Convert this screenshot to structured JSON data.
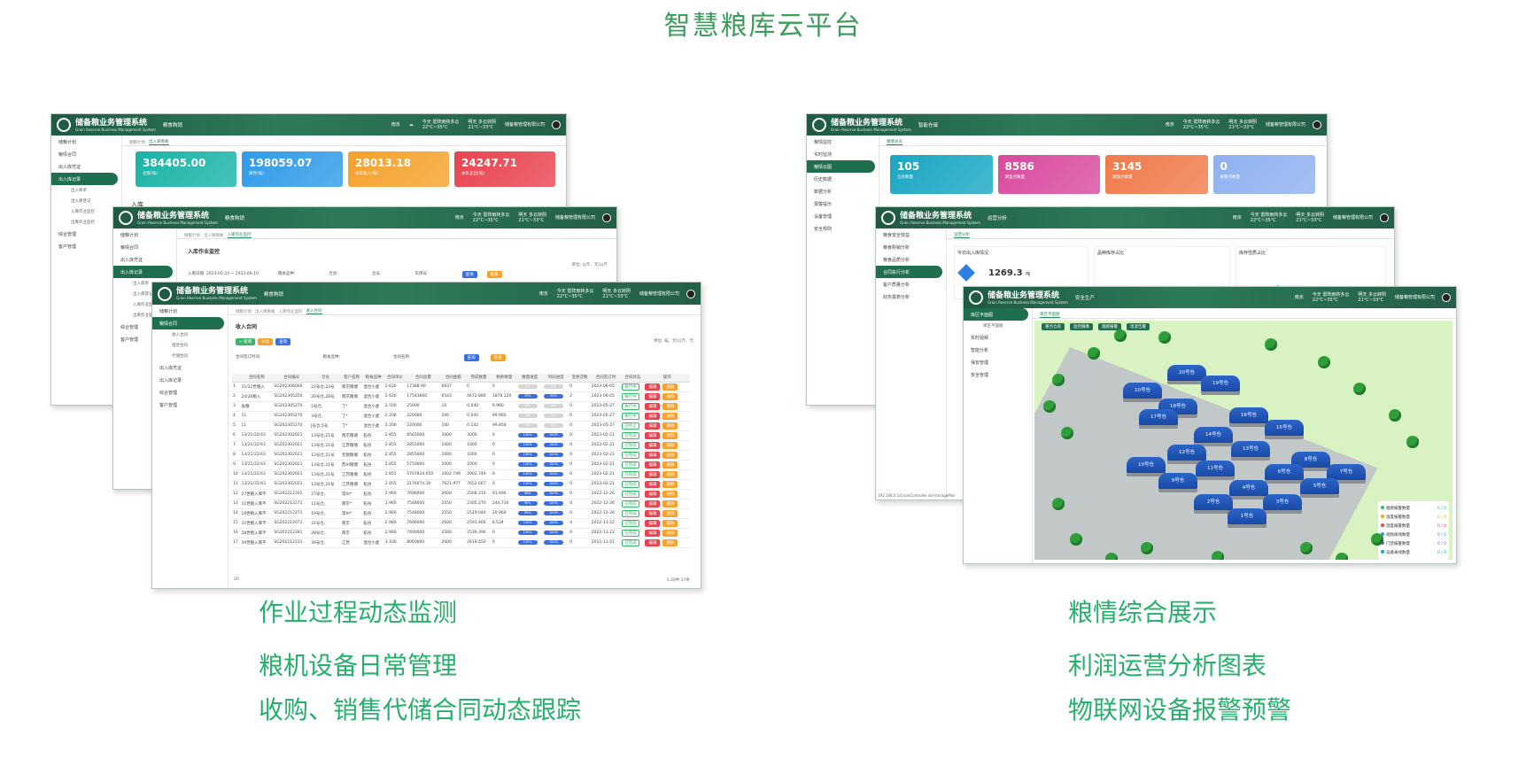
{
  "page_title": "智慧粮库云平台",
  "captions_left": [
    "作业过程动态监测",
    "粮机设备日常管理",
    "收购、销售代储合同动态跟踪"
  ],
  "captions_right": [
    "粮情综合展示",
    "利润运营分析图表",
    "物联网设备报警预警"
  ],
  "app": {
    "name": "储备粮业务管理系统",
    "subtitle": "Grain Reserve Business Management System",
    "weather_city": "南京",
    "weather_today": "今天 雷阵雨转多云",
    "weather_today_temp": "22°C~35°C",
    "weather_tomorrow": "明天 多云转阴",
    "weather_tomorrow_temp": "21°C~33°C",
    "company": "储备粮管理有限公司",
    "user": "超级管理员"
  },
  "w1": {
    "module": "粮食购销",
    "sidebar": [
      "储粮计划",
      "粮情合同",
      "出入库凭证",
      "出入库记录",
      "出入库单",
      "出入库登记",
      "入库作业监控",
      "出库作业监控",
      "综合管理",
      "客户管理"
    ],
    "tabs": [
      "储粮计划",
      "出入库看板"
    ],
    "cards": [
      {
        "value": "384405.00",
        "label": "仓容(吨)",
        "color": "#19b3a6"
      },
      {
        "value": "198059.07",
        "label": "库存(吨)",
        "color": "#2f9be8"
      },
      {
        "value": "28013.18",
        "label": "本年收入(吨)",
        "color": "#f5a12b"
      },
      {
        "value": "24247.71",
        "label": "本年支出(吨)",
        "color": "#e9434f"
      }
    ],
    "section": "入库"
  },
  "w2": {
    "module": "粮食购销",
    "sidebar": [
      "储粮计划",
      "粮情合同",
      "出入库凭证",
      "出入库记录",
      "出入库单",
      "出入库登记",
      "入库作业监控",
      "出库作业监控",
      "综合管理",
      "客户管理"
    ],
    "tabs": [
      "储粮计划",
      "出入库看板",
      "入库作业监控"
    ],
    "panel_title": "入库作业监控",
    "unit": "单位: 公斤、元/公斤",
    "filter_date": "入库日期: 2023-05-24 ~ 2023-06-10",
    "filter_grain": "粮食品种:",
    "filter_house": "仓房:",
    "filter_bin": "仓号:",
    "filter_car": "车牌号:",
    "query": "查询",
    "reset": "重置"
  },
  "w3": {
    "module": "粮食购销",
    "sidebar": [
      "储粮计划",
      "粮情合同",
      "收入合同",
      "租赁合同",
      "代储合同",
      "出入库凭证",
      "出入库记录",
      "综合管理",
      "客户管理"
    ],
    "tabs": [
      "储粮计划",
      "出入库看板",
      "入库作业监控",
      "收入合同"
    ],
    "panel_title": "收入合同",
    "unit": "单位: 吨、元/公斤、元",
    "btn_add": "+ 新增",
    "btn_import": "导出",
    "btn_search": "查询",
    "query": "查询",
    "reset": "重置",
    "filter_date": "合同签订时间:",
    "filter_grain": "粮食品种:",
    "filter_name": "合同名称:",
    "columns": [
      "",
      "合同名称",
      "合同编号",
      "仓号",
      "客户名称",
      "粮食品种",
      "合同单价",
      "合同总量",
      "合同金额",
      "完成数量",
      "剩余数量",
      "数量进度",
      "时间进度",
      "变更次数",
      "合同签订时",
      "合同状态",
      "操作"
    ],
    "rows": [
      [
        "1",
        "21/22世粮入",
        "SG202306060",
        "22号仓,23号",
        "南京粮储",
        "混合小麦",
        "2.620",
        "17388.90",
        "6637",
        "0",
        "0",
        "0%",
        "0%",
        "0",
        "2023-06-05",
        "执行中"
      ],
      [
        "2",
        "24/26粮入",
        "SG202305250",
        "26号仓,28号",
        "南京粮储",
        "混合小麦",
        "2.620",
        "17543660",
        "6543",
        "4672.880",
        "1870.120",
        "70%",
        "40%",
        "2",
        "2023-06-05",
        "执行中"
      ],
      [
        "3",
        "省粮",
        "SG202305270",
        "2号仓,",
        "丁*",
        "混合小麦",
        "2.500",
        "25000",
        "10",
        "0.040",
        "9.960",
        "0%",
        "0%",
        "0",
        "2023-05-27",
        "执行中"
      ],
      [
        "4",
        "11",
        "SG202305270",
        "3号仓,",
        "丁*",
        "混合小麦",
        "2.200",
        "220000",
        "100",
        "0.040",
        "99.960",
        "0%",
        "0%",
        "0",
        "2023-05-27",
        "执行中"
      ],
      [
        "5",
        "11",
        "SG202305270",
        "J号仓,5号",
        "丁*",
        "混合小麦",
        "2.200",
        "220000",
        "100",
        "0.142",
        "99.858",
        "0%",
        "0%",
        "0",
        "2023-05-27",
        "已终止"
      ],
      [
        "6",
        "13/21/22/43",
        "SG202302021",
        "13号仓,21号",
        "南京粮储",
        "稻谷",
        "2.855",
        "8565000",
        "3000",
        "3000",
        "0",
        "100%",
        "100%",
        "0",
        "2023-02-21",
        "已完成"
      ],
      [
        "7",
        "13/21/22/43",
        "SG202302021",
        "13号仓,21号",
        "江苏粮储",
        "稻谷",
        "2.855",
        "2855000",
        "1000",
        "1000",
        "0",
        "100%",
        "100%",
        "0",
        "2023-02-21",
        "已完成"
      ],
      [
        "8",
        "13/21/22/43",
        "SG202302021",
        "13号仓,21号",
        "无锡粮储",
        "稻谷",
        "2.855",
        "2855000",
        "1000",
        "1000",
        "0",
        "100%",
        "100%",
        "0",
        "2023-02-21",
        "已完成"
      ],
      [
        "9",
        "13/21/22/43",
        "SG202302021",
        "13号仓,21号",
        "苏州粮储",
        "稻谷",
        "2.855",
        "5710000",
        "2000",
        "2000",
        "0",
        "100%",
        "100%",
        "0",
        "2023-02-21",
        "已完成"
      ],
      [
        "10",
        "13/21/22/43",
        "SG202302021",
        "13号仓,21号",
        "江苏粮储",
        "稻谷",
        "2.855",
        "5707834.650",
        "2002.749",
        "2002.749",
        "0",
        "100%",
        "100%",
        "0",
        "2023-02-21",
        "已完成"
      ],
      [
        "11",
        "13/21/22/43",
        "SG202302021",
        "13号仓,21号",
        "江苏粮储",
        "稻谷",
        "2.855",
        "2176074.30",
        "7621.977",
        "7652.667",
        "0",
        "100%",
        "100%",
        "0",
        "2023-02-21",
        "已完成"
      ],
      [
        "12",
        "27世粮入库不",
        "SG202212201",
        "27号仓,",
        "常州*",
        "稻谷",
        "2.960",
        "7696000",
        "2600",
        "2508.310",
        "91.490",
        "96%",
        "100%",
        "0",
        "2022-12-26",
        "已完成"
      ],
      [
        "13",
        "11世粮入库不",
        "SG202212271",
        "11号仓,",
        "南京*",
        "稻谷",
        "2.960",
        "7548000",
        "2550",
        "2305.270",
        "244.730",
        "90%",
        "100%",
        "0",
        "2022-12-26",
        "已完成"
      ],
      [
        "14",
        "19世粮入库不",
        "SG202212271",
        "19号仓,",
        "常州*",
        "稻谷",
        "2.960",
        "7548000",
        "2550",
        "2529.040",
        "20.960",
        "99%",
        "100%",
        "0",
        "2022-12-26",
        "已完成"
      ],
      [
        "15",
        "31世粮入库不",
        "SG202212071",
        "31号仓,",
        "南京",
        "稻谷",
        "2.960",
        "7696000",
        "2600",
        "2593.466",
        "6.534",
        "100%",
        "100%",
        "4",
        "2022-11-22",
        "已完成"
      ],
      [
        "16",
        "28世粮入库不",
        "SG202212281",
        "28号仓,",
        "南京",
        "稻谷",
        "2.960",
        "7400000",
        "2500",
        "2539.390",
        "0",
        "100%",
        "100%",
        "0",
        "2022-11-22",
        "已完成"
      ],
      [
        "17",
        "39世粮入库不",
        "SG202212211",
        "39号仓,",
        "江苏",
        "混合小麦",
        "3.100",
        "8060000",
        "2600",
        "2618.450",
        "0",
        "100%",
        "100%",
        "0",
        "2022-11-21",
        "已完成"
      ]
    ],
    "op_edit": "编辑",
    "op_del": "删除",
    "pager": "1-20共 17条",
    "page_size": "20"
  },
  "w4": {
    "module": "智能仓储",
    "sidebar": [
      "粮情监控",
      "实时监测",
      "粮情云图",
      "历史数据",
      "数据分析",
      "报警提示",
      "设备管理",
      "安全规则"
    ],
    "tabs": [
      "粮情总览"
    ],
    "cards": [
      {
        "value": "105",
        "label": "仓房数量",
        "color": "#19a6c4"
      },
      {
        "value": "8586",
        "label": "测温点数量",
        "color": "#d94a9d"
      },
      {
        "value": "3145",
        "label": "测湿点数量",
        "color": "#f07a4a"
      },
      {
        "value": "0",
        "label": "报警点数量",
        "color": "#8fb1f0"
      }
    ]
  },
  "w5": {
    "module": "运营分析",
    "sidebar": [
      "粮食安全效益",
      "粮食购销分析",
      "粮食品质分析",
      "合同执行分析",
      "客户质量分析",
      "财务报表分析"
    ],
    "tabs": [
      "运营分析"
    ],
    "panels": [
      "今日出入库情况",
      "品种库存占比",
      "库存性质占比"
    ],
    "value": "1269.3",
    "unit": "吨",
    "status_url": "192.168.0.1/GrainController.do?storageMon"
  },
  "w6": {
    "module": "安全生产",
    "sidebar": [
      "库区平面图",
      "库区平面图",
      "实时视频",
      "智能分析",
      "保安管理",
      "安全管理"
    ],
    "tabs": [
      "库区平面图"
    ],
    "chips": [
      "重点仓房",
      "监控摄像",
      "烟感报警",
      "温湿告警"
    ],
    "warehouses": [
      "20号仓",
      "19号仓",
      "10号仓",
      "18号仓",
      "17号仓",
      "16号仓",
      "15号仓",
      "14号仓",
      "13号仓",
      "12号仓",
      "11号仓",
      "10号仓",
      "9号仓",
      "8号仓",
      "7号仓",
      "6号仓",
      "5号仓",
      "4号仓",
      "3号仓",
      "2号仓",
      "1号仓"
    ],
    "gate": "大门",
    "legend": [
      {
        "label": "烟感报警数量",
        "value": "0 / 0",
        "color": "#3bb36a"
      },
      {
        "label": "温度报警数量",
        "value": "0 / 0",
        "color": "#f5a12b"
      },
      {
        "label": "湿度报警数量",
        "value": "0 / 0",
        "color": "#e9434f"
      },
      {
        "label": "视频离线数量",
        "value": "0 / 0",
        "color": "#2f9be8"
      },
      {
        "label": "门禁报警数量",
        "value": "0 / 0",
        "color": "#8a5bd8"
      },
      {
        "label": "设备离线数量",
        "value": "0 / 0",
        "color": "#19a6c4"
      }
    ]
  }
}
